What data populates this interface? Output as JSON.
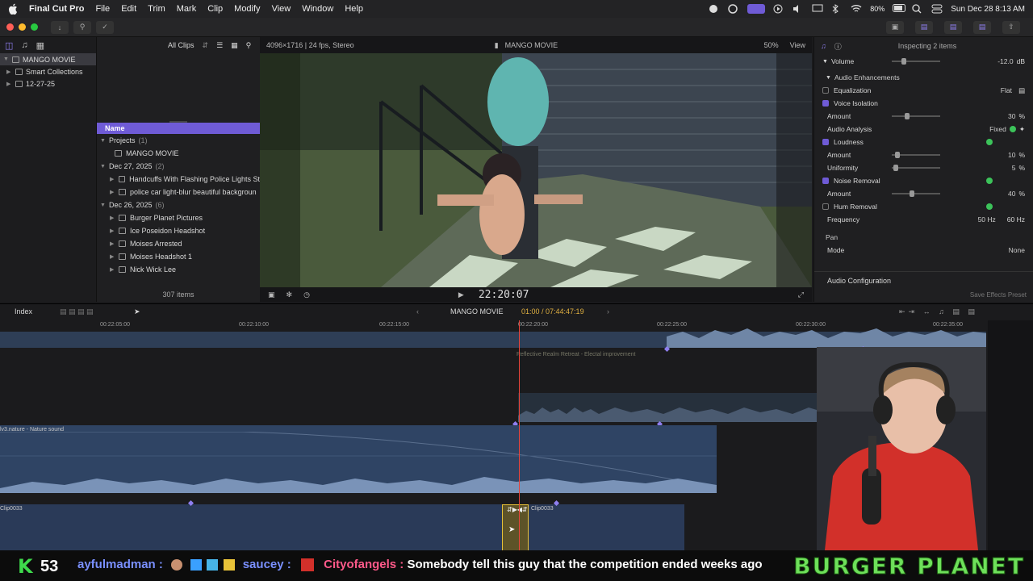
{
  "menubar": {
    "app_name": "Final Cut Pro",
    "items": [
      "File",
      "Edit",
      "Trim",
      "Mark",
      "Clip",
      "Modify",
      "View",
      "Window",
      "Help"
    ],
    "battery": "80%",
    "datetime": "Sun Dec 28  8:13 AM"
  },
  "libraries": {
    "items": [
      {
        "label": "MANGO MOVIE",
        "selected": true
      },
      {
        "label": "Smart Collections"
      },
      {
        "label": "12-27-25"
      }
    ]
  },
  "browser": {
    "filter": "All Clips",
    "column_header": "Name",
    "groups": [
      {
        "label": "Projects",
        "count": "(1)",
        "items": [
          "MANGO MOVIE"
        ]
      },
      {
        "label": "Dec 27, 2025",
        "count": "(2)",
        "items": [
          "Handcuffs With Flashing Police Lights St",
          "police car light-blur beautiful backgroun"
        ]
      },
      {
        "label": "Dec 26, 2025",
        "count": "(6)",
        "items": [
          "Burger Planet Pictures",
          "Ice Poseidon Headshot",
          "Moises Arrested",
          "Moises Headshot 1",
          "Nick Wick Lee"
        ]
      }
    ],
    "footer": "307 items"
  },
  "viewer": {
    "format": "4096×1716 | 24 fps, Stereo",
    "title": "MANGO MOVIE",
    "zoom": "50%",
    "view_label": "View",
    "timecode": "22:20:07"
  },
  "inspector": {
    "header": "Inspecting 2 items",
    "volume": {
      "label": "Volume",
      "value": "-12.0",
      "unit": "dB"
    },
    "section": "Audio Enhancements",
    "rows": [
      {
        "label": "Equalization",
        "value": "Flat",
        "checkbox": false
      },
      {
        "label": "Voice Isolation",
        "checkbox": true
      },
      {
        "label": "Amount",
        "value": "30",
        "unit": "%",
        "level": 0.3
      },
      {
        "label": "Audio Analysis",
        "value": "Fixed"
      },
      {
        "label": "Loudness",
        "checkbox": true
      },
      {
        "label": "Amount",
        "value": "10",
        "unit": "%",
        "level": 0.1
      },
      {
        "label": "Uniformity",
        "value": "5",
        "unit": "%",
        "level": 0.05
      },
      {
        "label": "Noise Removal",
        "checkbox": true
      },
      {
        "label": "Amount",
        "value": "40",
        "unit": "%",
        "level": 0.4
      },
      {
        "label": "Hum Removal",
        "checkbox": false
      },
      {
        "label": "Frequency",
        "value": "50 Hz",
        "value2": "60 Hz"
      }
    ],
    "pan_label": "Pan",
    "pan_mode_label": "Mode",
    "pan_mode_value": "None",
    "audio_config": "Audio Configuration",
    "save_preset": "Save Effects Preset"
  },
  "timeline": {
    "index_label": "Index",
    "project": "MANGO MOVIE",
    "timecode": "01:00 / 07:44:47:19",
    "ruler": [
      "00:22:05:00",
      "00:22:10:00",
      "00:22:15:00",
      "00:22:20:00",
      "00:22:25:00",
      "00:22:30:00",
      "00:22:35:00"
    ],
    "clip_music": "Reflective Realm Retreat - Electal improvement",
    "clip_nature": "lv3.nature - Nature sound",
    "clip_a": "Clip0033",
    "clip_b": "Clip0033"
  },
  "overlay": {
    "kick_count": "53",
    "user1": "ayfulmadman :",
    "user2": "saucey :",
    "user3": "Cityofangels :",
    "message": "Somebody tell this guy that the competition ended weeks ago",
    "brand": "BURGER PLANET"
  }
}
